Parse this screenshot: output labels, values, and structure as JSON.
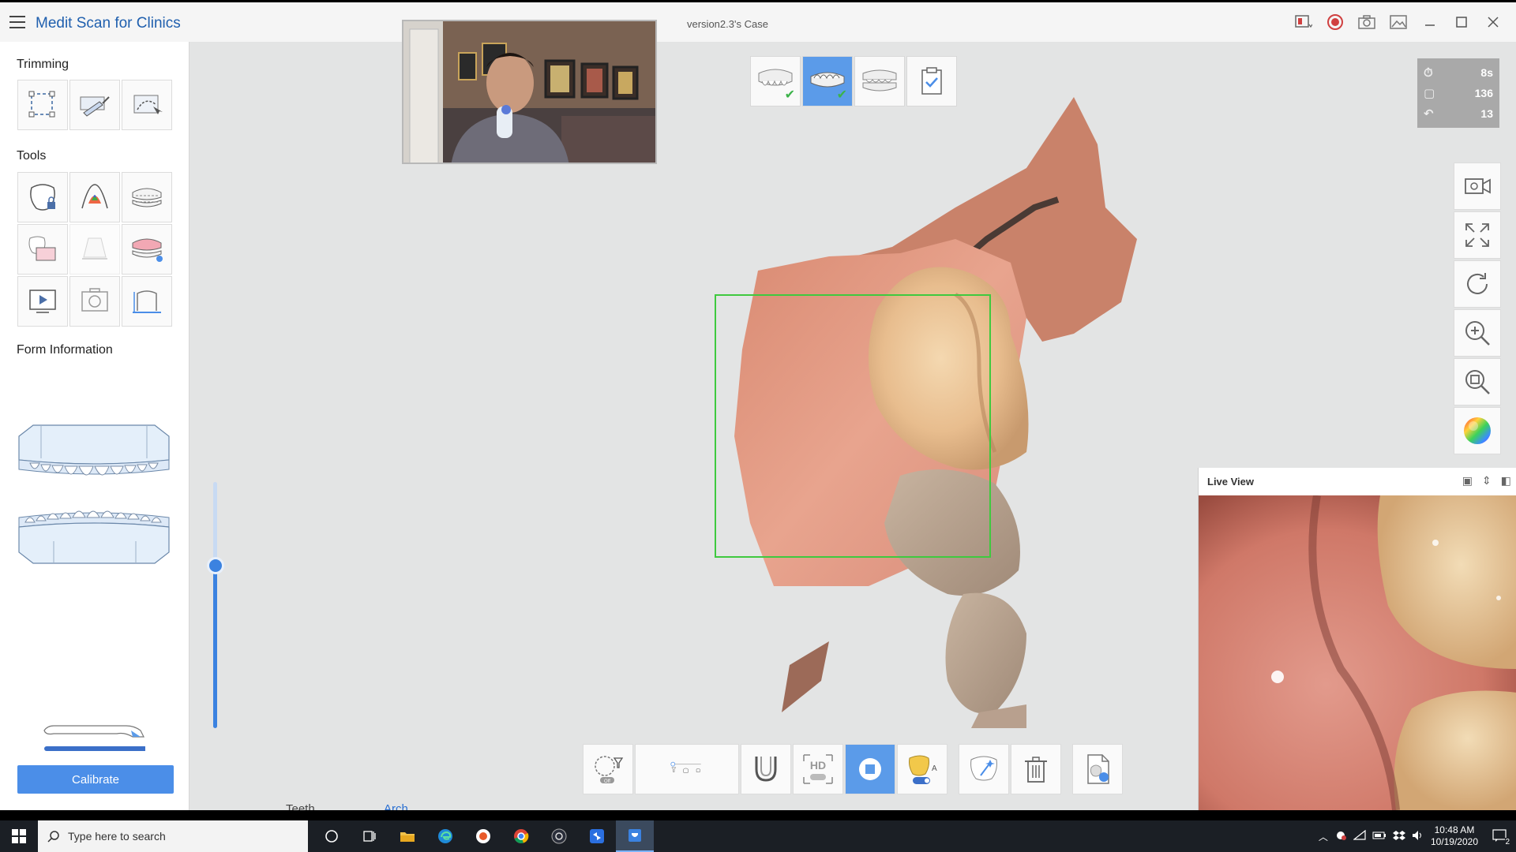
{
  "window": {
    "app_title": "Medit Scan for Clinics",
    "case_title": "version2.3's Case"
  },
  "left_panel": {
    "trimming_title": "Trimming",
    "tools_title": "Tools",
    "form_info_title": "Form Information",
    "calibrate_label": "Calibrate"
  },
  "stats": {
    "time": "8s",
    "frames": "136",
    "count": "13"
  },
  "live_view": {
    "title": "Live View"
  },
  "bottom_tabs": {
    "teeth": "Teeth",
    "arch": "Arch"
  },
  "slider": {
    "level": 0.66
  },
  "taskbar": {
    "search_placeholder": "Type here to search",
    "time": "10:48 AM",
    "date": "10/19/2020",
    "notification_count": "2"
  },
  "colors": {
    "accent": "#4b8ee8",
    "active_stage": "#5b9be9",
    "roi": "#3fc93f",
    "brand_text": "#1f5fae"
  }
}
